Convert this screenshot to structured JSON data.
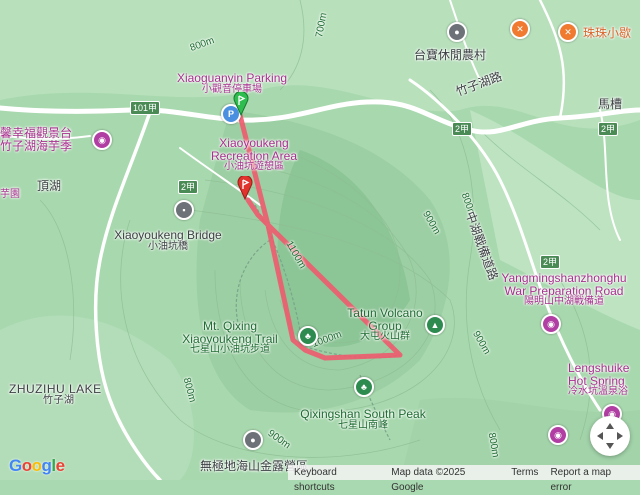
{
  "labels": {
    "xiaoguanyin_parking_en": "Xiaoguanyin Parking",
    "xiaoguanyin_parking_zh": "小觀音停車場",
    "xiaoyoukeng_area_en1": "Xiaoyoukeng",
    "xiaoyoukeng_area_en2": "Recreation Area",
    "xiaoyoukeng_area_zh": "小油坑遊憩區",
    "xiaoyoukeng_bridge_en": "Xiaoyoukeng Bridge",
    "xiaoyoukeng_bridge_zh": "小油坑橋",
    "qixing_trail_en1": "Mt. Qixing",
    "qixing_trail_en2": "Xiaoyoukeng Trail",
    "qixing_trail_zh": "七星山小油坑步道",
    "tatun_en1": "Tatun Volcano",
    "tatun_en2": "Group",
    "tatun_zh": "大屯火山群",
    "qixing_south_en": "Qixingshan South Peak",
    "qixing_south_zh": "七星山南峰",
    "zhuzihu_lake_en": "ZHUZIHU LAKE",
    "zhuzihu_lake_zh": "竹子湖",
    "dinghu": "頂湖",
    "yangming_en1": "Yangmingshanzhonghu",
    "yangming_en2": "War Preparation Road",
    "yangming_zh": "陽明山中湖戰備道",
    "lengshui_en1": "Lengshuike",
    "lengshui_en2": "Hot Spring",
    "lengshui_zh": "冷水坑溫泉浴",
    "taibao_farm": "台寶休閒農村",
    "zhuzihu_road": "竹子湖路",
    "zhonghu_road": "中湖戰備道路",
    "zhuzhu_shop": "珠珠小歇",
    "macao": "馬槽",
    "xinfu_top": "馨幸福觀景台",
    "zhuzihu_taro": "竹子湖海芋季",
    "campground_bottom": "無極地海山金露營區",
    "yuan_fragment": "芋園",
    "road_101": "101甲",
    "road_2a_1": "2甲",
    "road_2a_2": "2甲",
    "road_2a_3": "2甲",
    "road_2a_4": "2甲",
    "contour_700": "700m",
    "contour_800_a": "800m",
    "contour_800_b": "800m",
    "contour_800_c": "800m",
    "contour_800_d": "800m",
    "contour_900_a": "900m",
    "contour_900_b": "900m",
    "contour_900_c": "900m",
    "contour_1000": "1000m",
    "contour_1100": "1100m"
  },
  "icons": {
    "parking": "P",
    "start_marker": "green-flag-marker",
    "end_marker": "red-pin-marker",
    "landmark": "camera-icon",
    "park": "tree-icon",
    "mountain": "mountain-icon",
    "restaurant": "fork-knife-icon",
    "gray_place": "dot-icon"
  },
  "footer": {
    "google": "Google",
    "keyboard_shortcuts": "Keyboard shortcuts",
    "map_data": "Map data ©2025 Google",
    "terms": "Terms",
    "report": "Report a map error"
  },
  "colors": {
    "route": "#f05a6e",
    "terrain": "#a9d9b0",
    "road": "#ffffff",
    "poi_purple": "#b13ea3",
    "start_marker": "#2ebd4e",
    "end_marker": "#e0342d"
  }
}
